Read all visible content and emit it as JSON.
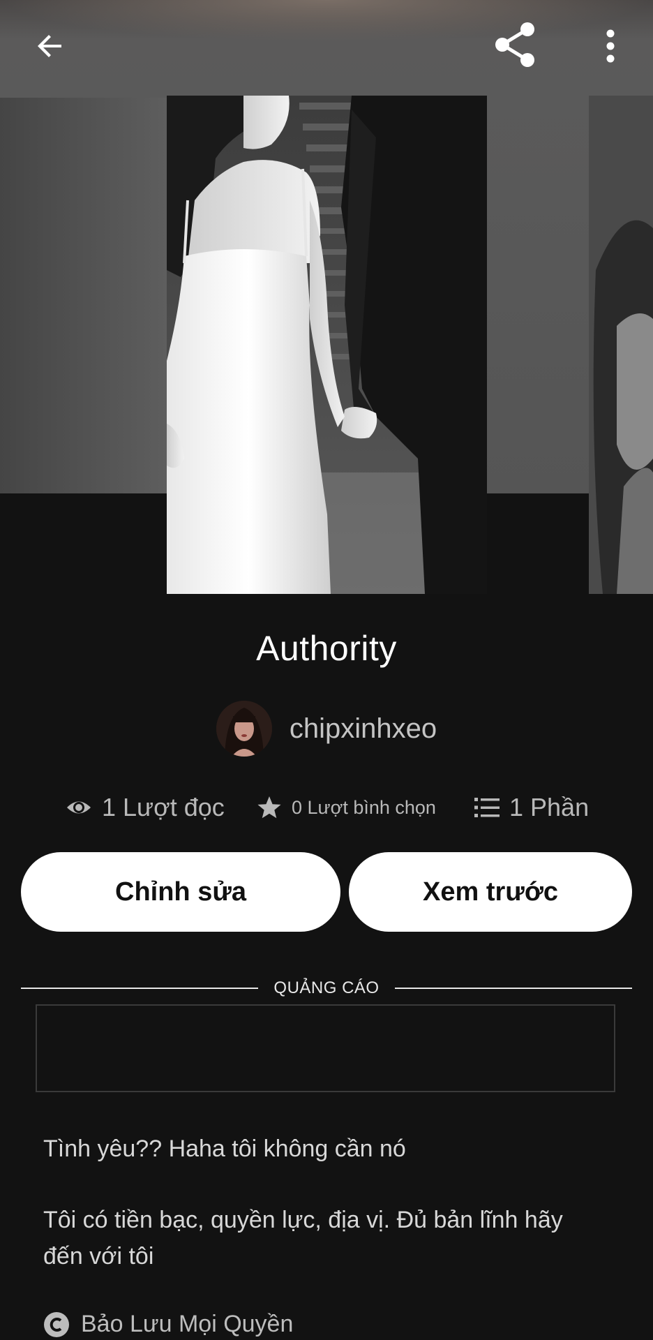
{
  "header": {
    "back_icon": "arrow-left-icon",
    "share_icon": "share-icon",
    "more_icon": "more-vertical-icon"
  },
  "story": {
    "title": "Authority",
    "author": "chipxinhxeo"
  },
  "stats": {
    "reads": "1 Lượt đọc",
    "votes": "0 Lượt bình chọn",
    "parts": "1 Phần"
  },
  "actions": {
    "edit_label": "Chỉnh sửa",
    "preview_label": "Xem trước"
  },
  "ad": {
    "label": "QUẢNG CÁO"
  },
  "description": {
    "line1": "Tình yêu?? Haha tôi không cần nó",
    "line2": "Tôi có tiền bạc, quyền lực, địa vị. Đủ bản lĩnh hãy đến với tôi"
  },
  "copyright": {
    "label": "Bảo Lưu Mọi Quyền"
  },
  "colors": {
    "background": "#121212",
    "button_bg": "#ffffff",
    "button_text": "#111111",
    "muted_text": "#b9b9b9"
  }
}
